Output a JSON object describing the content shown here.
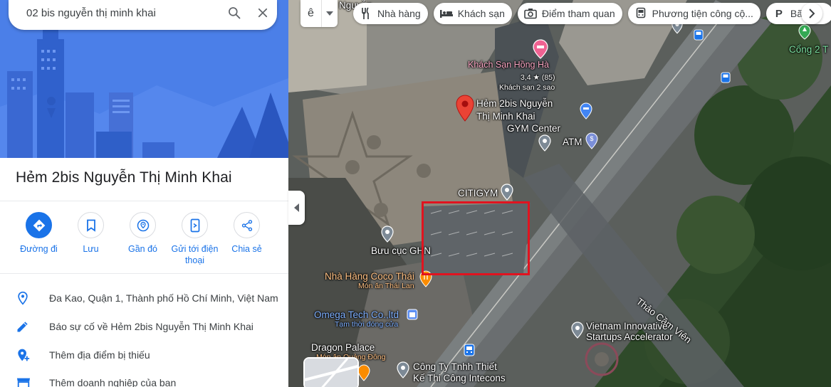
{
  "search": {
    "value": "02 bis nguyễn thị minh khai"
  },
  "place": {
    "title": "Hẻm 2bis Nguyễn Thị Minh Khai"
  },
  "actions": [
    {
      "label": "Đường đi",
      "icon": "directions-icon"
    },
    {
      "label": "Lưu",
      "icon": "bookmark-icon"
    },
    {
      "label": "Gần đó",
      "icon": "nearby-icon"
    },
    {
      "label": "Gửi tới điện thoại",
      "icon": "send-to-phone-icon"
    },
    {
      "label": "Chia sẻ",
      "icon": "share-icon"
    }
  ],
  "info": {
    "address": "Đa Kao, Quận 1, Thành phố Hồ Chí Minh, Việt Nam",
    "report": "Báo sự cố về Hẻm 2bis Nguyễn Thị Minh Khai",
    "add_place": "Thêm địa điểm bị thiếu",
    "add_business": "Thêm doanh nghiệp của bạn"
  },
  "map": {
    "chips": [
      {
        "label": "Nhà hàng",
        "icon": "restaurant-icon"
      },
      {
        "label": "Khách sạn",
        "icon": "hotel-icon"
      },
      {
        "label": "Điểm tham quan",
        "icon": "camera-icon"
      },
      {
        "label": "Phương tiện công cộ...",
        "icon": "transit-icon"
      },
      {
        "label": "Bãi",
        "icon": "parking-icon"
      }
    ],
    "labels": {
      "top_road": "Nguyễn",
      "hotel_name": "Khách Sạn Hồng Hà",
      "hotel_rating": "3,4 ★ (85)",
      "hotel_class": "Khách sạn 2 sao",
      "selected_place_line1": "Hẻm 2bis Nguyễn",
      "selected_place_line2": "Thị Minh Khai",
      "gym_center": "GYM Center",
      "atm": "ATM",
      "citigym": "CITIGYM",
      "post_office": "Bưu cục GHN",
      "coco_thai": "Nhà Hàng Coco Thái",
      "coco_thai_sub": "Món ăn Thái Lan",
      "omega": "Omega Tech Co.,ltd",
      "omega_sub": "Tạm thời đóng cửa",
      "dragon_palace": "Dragon Palace",
      "dragon_palace_sub": "Món ăn Quảng Đông",
      "intecons_line1": "Công Ty Tnhh Thiết",
      "intecons_line2": "Kế Thi Công Intecons",
      "thao_cam_vien": "Thảo Cầm Viên",
      "vn_innovative_line1": "Vietnam Innovative",
      "vn_innovative_line2": "Startups Accelerator",
      "cong2": "Cổng 2 T"
    }
  }
}
